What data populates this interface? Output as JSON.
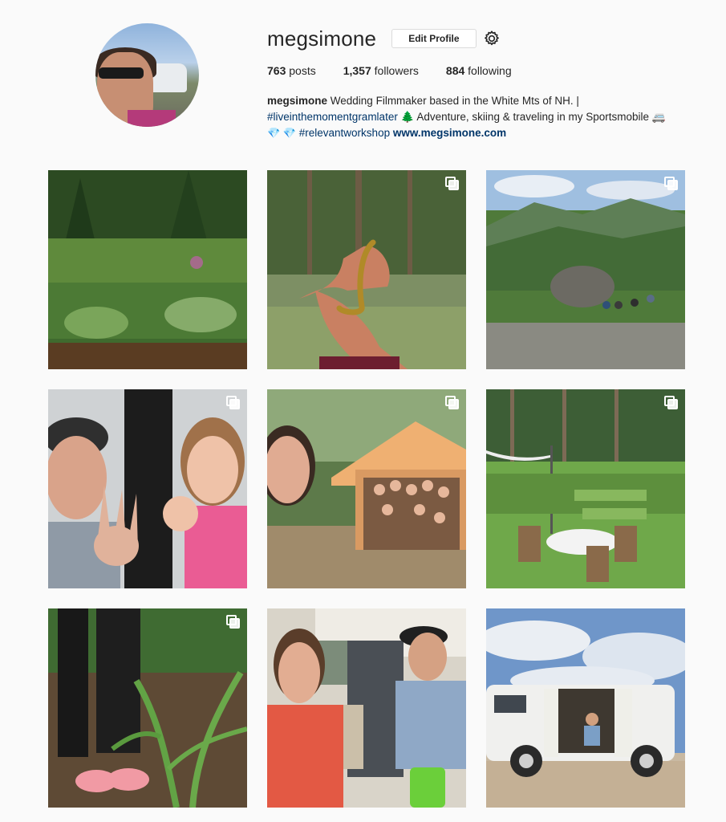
{
  "profile": {
    "username": "megsimone",
    "edit_label": "Edit Profile",
    "stats": {
      "posts_count": "763",
      "posts_label": "posts",
      "followers_count": "1,357",
      "followers_label": "followers",
      "following_count": "884",
      "following_label": "following"
    },
    "bio": {
      "name": "megsimone",
      "line1_text": " Wedding Filmmaker based in the White Mts of NH. |",
      "hashtag1": "#liveinthemomentgramlater",
      "line2_text": " 🌲 Adventure, skiing & traveling in my Sportsmobile 🚐",
      "gems": "💎 💎",
      "hashtag2": "#relevantworkshop",
      "website": "www.megsimone.com"
    }
  },
  "posts": [
    {
      "alt": "garden",
      "multi": false
    },
    {
      "alt": "salamander",
      "multi": true
    },
    {
      "alt": "mountain",
      "multi": true
    },
    {
      "alt": "selfie",
      "multi": true
    },
    {
      "alt": "tent",
      "multi": true
    },
    {
      "alt": "patio",
      "multi": true
    },
    {
      "alt": "corn",
      "multi": true
    },
    {
      "alt": "van-interior",
      "multi": false
    },
    {
      "alt": "van",
      "multi": false
    }
  ]
}
